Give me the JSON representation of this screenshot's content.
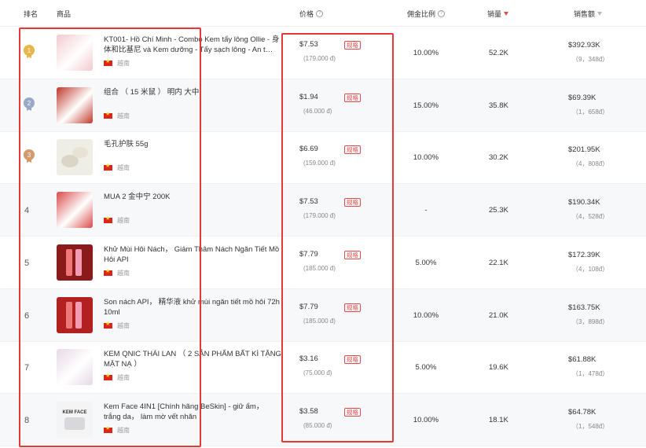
{
  "headers": {
    "rank": "排名",
    "product": "商品",
    "price": "价格",
    "commission": "佣金比例",
    "sales": "销量",
    "amount": "销售额"
  },
  "rows": [
    {
      "rank": "1",
      "name": "KT001- Hồ Chí Minh - Combo Kem tẩy lông Ollie - 身体和比基尼 và Kem dưỡng - Tẩy sạch lông - An t…",
      "country": "越南",
      "price": "$7.53",
      "price_tag": "规格",
      "price_local": "(179.000 đ)",
      "commission": "10.00%",
      "sales": "52.2K",
      "amount": "$392.93K",
      "amount_sub": "（9，348đ）"
    },
    {
      "rank": "2",
      "name": "组合 （ 15 米鼠 ） 明内 大中",
      "country": "越南",
      "price": "$1.94",
      "price_tag": "规格",
      "price_local": "(46.000 đ)",
      "commission": "15.00%",
      "sales": "35.8K",
      "amount": "$69.39K",
      "amount_sub": "（1，658đ）"
    },
    {
      "rank": "3",
      "name": "毛孔护肤 55g",
      "country": "越南",
      "price": "$6.69",
      "price_tag": "规格",
      "price_local": "(159.000 đ)",
      "commission": "10.00%",
      "sales": "30.2K",
      "amount": "$201.95K",
      "amount_sub": "（4，808đ）"
    },
    {
      "rank": "4",
      "name": "MUA 2 金中宁 200K",
      "country": "越南",
      "price": "$7.53",
      "price_tag": "规格",
      "price_local": "(179.000 đ)",
      "commission": "-",
      "sales": "25.3K",
      "amount": "$190.34K",
      "amount_sub": "（4，528đ）"
    },
    {
      "rank": "5",
      "name": "Khử Mùi Hôi Nách， Giảm Thâm Nách Ngăn Tiết Mồ Hôi API",
      "country": "越南",
      "price": "$7.79",
      "price_tag": "规格",
      "price_local": "(185.000 đ)",
      "commission": "5.00%",
      "sales": "22.1K",
      "amount": "$172.39K",
      "amount_sub": "（4，108đ）"
    },
    {
      "rank": "6",
      "name": "Son nách API， 精华液 khử mùi ngăn tiết mồ hôi 72h 10ml",
      "country": "越南",
      "price": "$7.79",
      "price_tag": "规格",
      "price_local": "(185.000 đ)",
      "commission": "10.00%",
      "sales": "21.0K",
      "amount": "$163.75K",
      "amount_sub": "（3，898đ）"
    },
    {
      "rank": "7",
      "name": "KEM QNIC THÁI LAN （ 2 SẢN PHẨM BẤT KÌ TẶNG MẶT NẠ ）",
      "country": "越南",
      "price": "$3.16",
      "price_tag": "规格",
      "price_local": "(75.000 đ)",
      "commission": "5.00%",
      "sales": "19.6K",
      "amount": "$61.88K",
      "amount_sub": "（1，478đ）"
    },
    {
      "rank": "8",
      "name": "Kem Face 4IN1 [Chính hãng BeSkin] - giữ ẩm， trắng da， làm mờ vết nhăn",
      "country": "越南",
      "price": "$3.58",
      "price_tag": "规格",
      "price_local": "(85.000 đ)",
      "commission": "10.00%",
      "sales": "18.1K",
      "amount": "$64.78K",
      "amount_sub": "（1，548đ）"
    }
  ],
  "thumb_colors": [
    "#f3c9cf",
    "#c0392b",
    "#efeee6",
    "#d94b4b",
    "#8b1a1a",
    "#b32020",
    "#e7d9e6",
    "#f4f4f4"
  ],
  "thumb_text_row8": "KEM FACE",
  "highlight_color": "#e53935"
}
